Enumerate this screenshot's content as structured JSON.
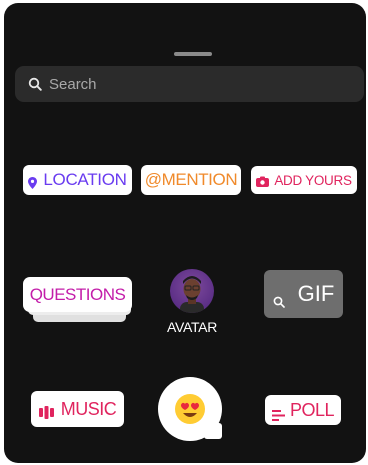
{
  "sheet": {
    "grabber_icon": "drag-handle-icon"
  },
  "search": {
    "placeholder": "Search",
    "icon": "search-icon"
  },
  "stickers": {
    "location": {
      "label": "LOCATION",
      "icon": "location-pin-icon",
      "color": "#6a3cf0"
    },
    "mention": {
      "label": "@MENTION",
      "color": "#f08a2b"
    },
    "add_yours": {
      "label": "ADD YOURS",
      "icon": "camera-icon",
      "color": "#e0245e"
    },
    "questions": {
      "label": "QUESTIONS",
      "color": "#c31ca9"
    },
    "avatar": {
      "label": "AVATAR",
      "icon": "avatar-icon"
    },
    "gif": {
      "label": "GIF",
      "icon": "search-icon",
      "background": "#6e6e6e"
    },
    "music": {
      "label": "MUSIC",
      "icon": "music-bars-icon",
      "color": "#e0245e"
    },
    "emoji_slider": {
      "icon": "heart-eyes-emoji-icon"
    },
    "poll": {
      "label": "POLL",
      "icon": "poll-lines-icon",
      "color": "#e0245e"
    }
  }
}
